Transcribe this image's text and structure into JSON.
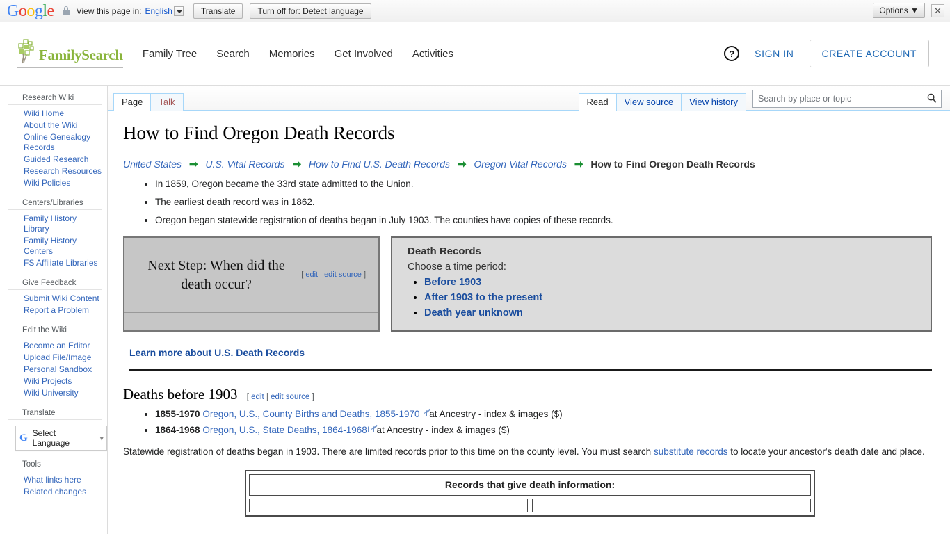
{
  "translate_bar": {
    "logo": "Google",
    "lock_icon": "lock-icon",
    "view_label": "View this page in:",
    "language": "English",
    "translate_button": "Translate",
    "turn_off_button": "Turn off for: Detect language",
    "options_button": "Options ▼",
    "close_icon": "✕"
  },
  "header": {
    "brand": "FamilySearch",
    "nav": [
      {
        "label": "Family Tree"
      },
      {
        "label": "Search"
      },
      {
        "label": "Memories"
      },
      {
        "label": "Get Involved"
      },
      {
        "label": "Activities"
      }
    ],
    "help_icon": "?",
    "sign_in": "SIGN IN",
    "create_account": "CREATE ACCOUNT"
  },
  "sidebar": {
    "groups": [
      {
        "heading": "Research Wiki",
        "links": [
          "Wiki Home",
          "About the Wiki",
          "Online Genealogy Records",
          "Guided Research",
          "Research Resources",
          "Wiki Policies"
        ]
      },
      {
        "heading": "Centers/Libraries",
        "links": [
          "Family History Library",
          "Family History Centers",
          "FS Affiliate Libraries"
        ]
      },
      {
        "heading": "Give Feedback",
        "links": [
          "Submit Wiki Content",
          "Report a Problem"
        ]
      },
      {
        "heading": "Edit the Wiki",
        "links": [
          "Become an Editor",
          "Upload File/Image",
          "Personal Sandbox",
          "Wiki Projects",
          "Wiki University"
        ]
      }
    ],
    "translate_heading": "Translate",
    "select_language": "Select Language",
    "tools_heading": "Tools",
    "tools_links": [
      "What links here",
      "Related changes"
    ]
  },
  "tabs": {
    "left": [
      {
        "label": "Page",
        "selected": true
      },
      {
        "label": "Talk",
        "selected": false
      }
    ],
    "right": [
      {
        "label": "Read",
        "selected": true
      },
      {
        "label": "View source",
        "selected": false
      },
      {
        "label": "View history",
        "selected": false
      }
    ]
  },
  "search": {
    "placeholder": "Search by place or topic",
    "value": "",
    "icon": "search-icon"
  },
  "main": {
    "title": "How to Find Oregon Death Records",
    "breadcrumb": [
      "United States",
      "U.S. Vital Records",
      "How to Find U.S. Death Records",
      "Oregon Vital Records"
    ],
    "breadcrumb_current": "How to Find Oregon Death Records",
    "breadcrumb_arrow": "➡",
    "intro_bullets": [
      "In 1859, Oregon became the 33rd state admitted to the Union.",
      "The earliest death record was in 1862.",
      "Oregon began statewide registration of deaths began in July 1903. The counties have copies of these records."
    ],
    "next_step": {
      "text": "Next Step: When did the death occur?",
      "edit_open": "[",
      "edit": "edit",
      "edit_sep": "|",
      "edit_source": "edit source",
      "edit_close": "]"
    },
    "death_records_box": {
      "title": "Death Records",
      "subtitle": "Choose a time period:",
      "options": [
        "Before 1903",
        "After 1903 to the present",
        "Death year unknown"
      ]
    },
    "learn_more": "Learn more about U.S. Death Records",
    "section_heading": "Deaths before 1903",
    "section_edit_open": "[",
    "section_edit": "edit",
    "section_edit_sep": "|",
    "section_edit_source": "edit source",
    "section_edit_close": "]",
    "record_items": [
      {
        "years": "1855-1970",
        "link": "Oregon, U.S., County Births and Deaths, 1855-1970",
        "suffix": "at Ancestry - index & images ($)"
      },
      {
        "years": "1864-1968",
        "link": "Oregon, U.S., State Deaths, 1864-1968",
        "suffix": "at Ancestry - index & images ($)"
      }
    ],
    "statewide_para_1": "Statewide registration of deaths began in 1903. There are limited records prior to this time on the county level. You must search ",
    "statewide_link": "substitute records",
    "statewide_para_2": " to locate your ancestor's death date and place.",
    "records_table_header": "Records that give death information:"
  },
  "colors": {
    "brand_green": "#8ab43c",
    "link_blue": "#3366bb",
    "bold_link_blue": "#1a4d9e",
    "breadcrumb_arrow_green": "#1a8e32",
    "box_gray": "#c6c6c6",
    "box_light_gray": "#dcdcdc",
    "tab_border_blue": "#a7d7f9",
    "signin_blue": "#1b66b3"
  }
}
